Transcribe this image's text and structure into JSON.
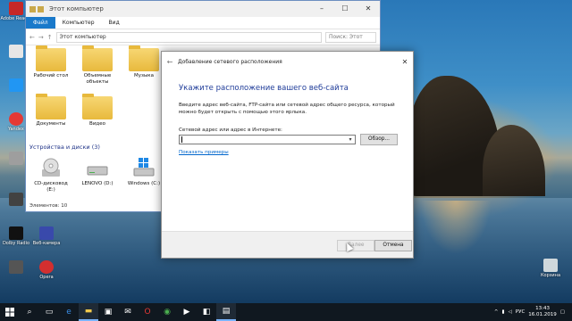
{
  "desktop_icons": [
    {
      "label": "Adobe Reader",
      "color": "#c62828"
    },
    {
      "label": "",
      "color": "#e6e6e6"
    },
    {
      "label": "",
      "color": "#2196f3"
    },
    {
      "label": "Yandex",
      "color": "#e53935"
    },
    {
      "label": "",
      "color": "#9e9e9e"
    },
    {
      "label": "",
      "color": "#424242"
    },
    {
      "label": "Dolby Radio",
      "color": "#111111"
    },
    {
      "label": "Веб-камера",
      "color": "#3949ab"
    },
    {
      "label": "",
      "color": "#555555"
    },
    {
      "label": "Opera",
      "color": "#d32f2f"
    }
  ],
  "recycle_bin": {
    "label": "Корзина"
  },
  "explorer": {
    "title": "Этот компьютер",
    "tabs": [
      "Файл",
      "Компьютер",
      "Вид"
    ],
    "address": "Этот компьютер",
    "search_placeholder": "Поиск: Этот",
    "folders": [
      {
        "label": "Рабочий стол"
      },
      {
        "label": "Объемные объекты"
      },
      {
        "label": "Музыка"
      },
      {
        "label": "Документы"
      },
      {
        "label": "Видео"
      }
    ],
    "devices_header": "Устройства и диски (3)",
    "drives": [
      {
        "label": "CD-дисковод (E:)"
      },
      {
        "label": "LENOVO (D:)"
      },
      {
        "label": "Windows (C:)"
      }
    ],
    "status": "Элементов: 10"
  },
  "wizard": {
    "title": "Добавление сетевого расположения",
    "heading": "Укажите расположение вашего веб-сайта",
    "description": "Введите адрес веб-сайта, FTP-сайта или сетевой адрес общего ресурса, который можно будет открыть с помощью этого ярлыка.",
    "field_label": "Сетевой адрес или адрес в Интернете:",
    "field_value": "",
    "browse_label": "Обзор...",
    "examples_link": "Показать примеры",
    "next_label": "Далее",
    "cancel_label": "Отмена"
  },
  "taskbar": {
    "language": "РУС",
    "time": "13:43",
    "date": "16.01.2019"
  },
  "colors": {
    "accent": "#1979ca",
    "heading": "#1f3c99",
    "link": "#0066cc"
  }
}
